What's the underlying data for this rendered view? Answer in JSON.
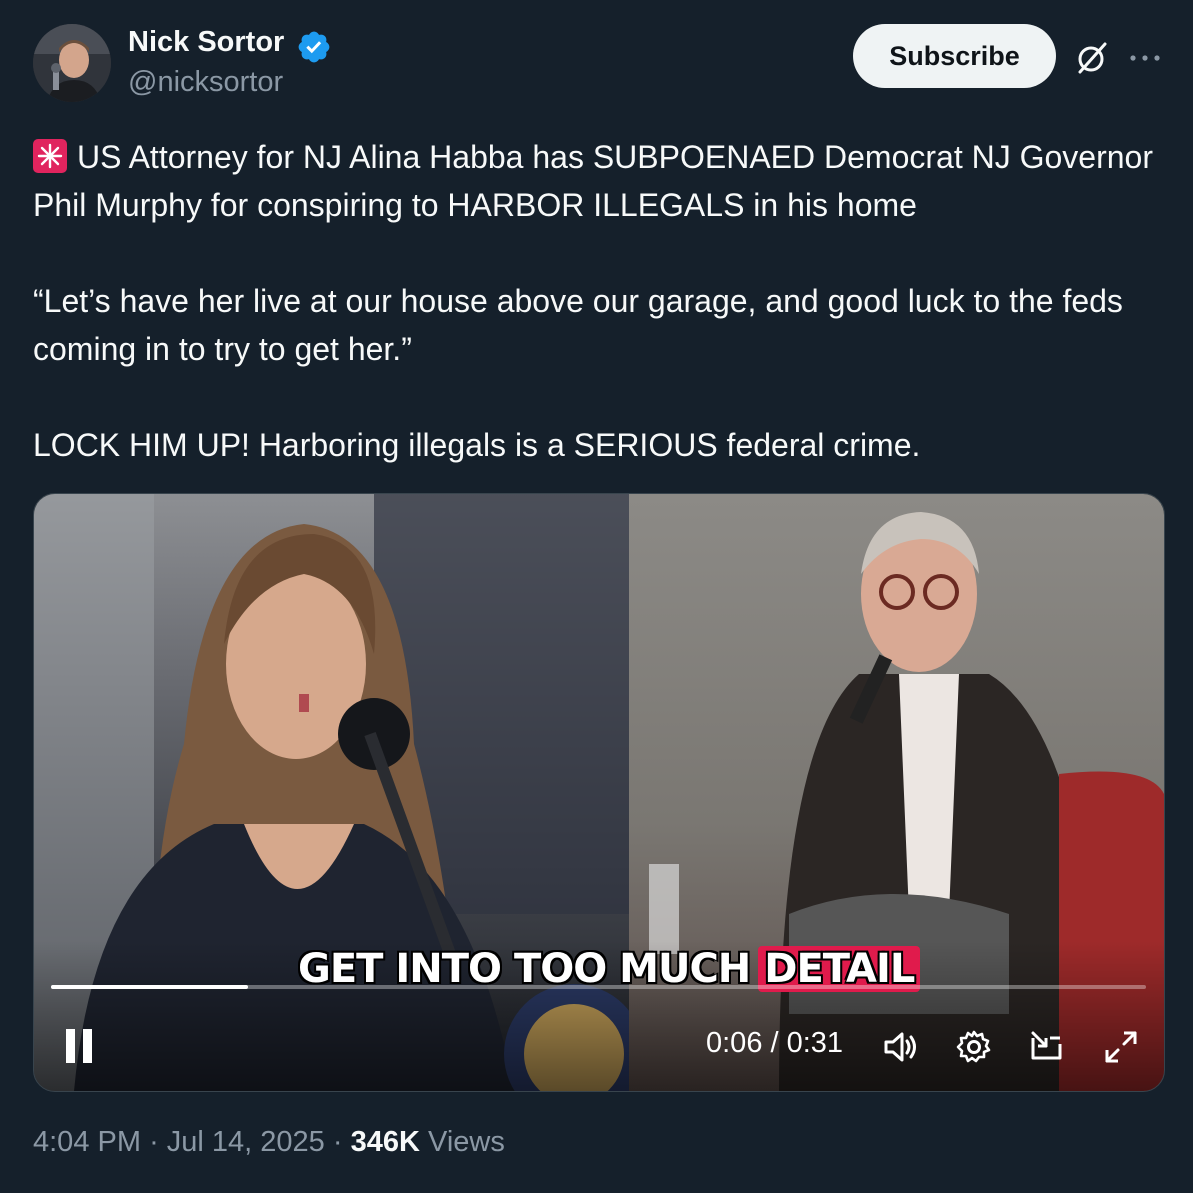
{
  "author": {
    "name": "Nick Sortor",
    "handle": "@nicksortor",
    "verified": true
  },
  "actions": {
    "subscribe_label": "Subscribe"
  },
  "tweet": {
    "line1": "US Attorney for NJ Alina Habba has SUBPOENAED Democrat NJ Governor Phil Murphy for conspiring to HARBOR ILLEGALS in his home",
    "line2": "“Let’s have her live at our house above our garage, and good luck to the feds coming in to try to get her.”",
    "line3": "LOCK HIM UP! Harboring illegals is a SERIOUS federal crime.",
    "emoji": "siren-icon"
  },
  "video": {
    "caption_main": "GET INTO TOO MUCH",
    "caption_highlight": "DETAIL",
    "time": "0:06 / 0:31",
    "progress": 0.18
  },
  "meta": {
    "time": "4:04 PM",
    "date": "Jul 14, 2025",
    "separator": "·",
    "views_count": "346K",
    "views_label": "Views"
  },
  "colors": {
    "background": "#15202b",
    "text": "#f7f9f9",
    "secondary": "#8b98a5",
    "verified": "#1d9bf0",
    "caption_highlight": "#e01b4c"
  }
}
